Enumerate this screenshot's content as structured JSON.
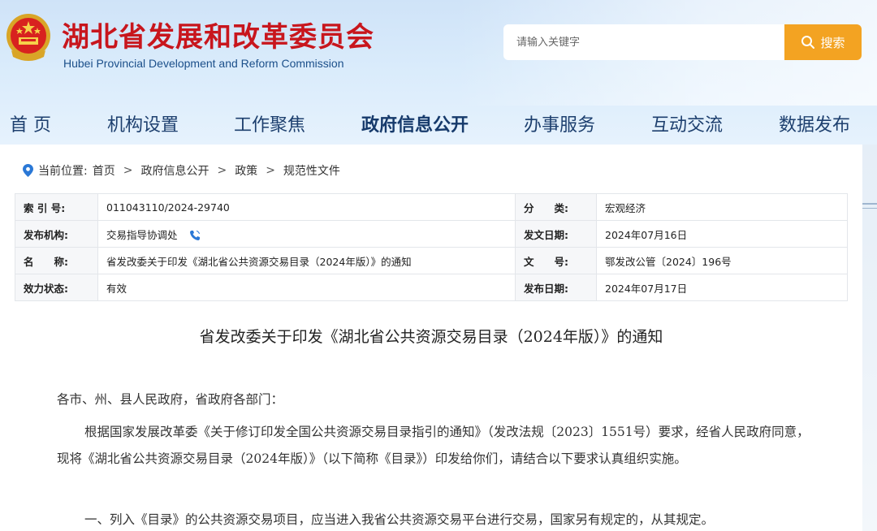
{
  "site": {
    "title": "湖北省发展和改革委员会",
    "subtitle": "Hubei Provincial Development and Reform Commission"
  },
  "search": {
    "placeholder": "请输入关键字",
    "button_label": "搜索"
  },
  "nav": {
    "items": [
      {
        "label": "首 页"
      },
      {
        "label": "机构设置"
      },
      {
        "label": "工作聚焦"
      },
      {
        "label": "政府信息公开",
        "active": true
      },
      {
        "label": "办事服务"
      },
      {
        "label": "互动交流"
      },
      {
        "label": "数据发布"
      }
    ]
  },
  "breadcrumb": {
    "prefix": "当前位置:",
    "items": [
      "首页",
      "政府信息公开",
      "政策",
      "规范性文件"
    ]
  },
  "meta": {
    "index_label": "索 引 号:",
    "index_value": "011043110/2024-29740",
    "category_label": "分　　类:",
    "category_value": "宏观经济",
    "publisher_label": "发布机构:",
    "publisher_value": "交易指导协调处",
    "issue_date_label": "发文日期:",
    "issue_date_value": "2024年07月16日",
    "name_label": "名　　称:",
    "name_value": "省发改委关于印发《湖北省公共资源交易目录（2024年版）》的通知",
    "doc_no_label": "文　　号:",
    "doc_no_value": "鄂发改公管〔2024〕196号",
    "status_label": "效力状态:",
    "status_value": "有效",
    "publish_date_label": "发布日期:",
    "publish_date_value": "2024年07月17日"
  },
  "document": {
    "title": "省发改委关于印发《湖北省公共资源交易目录（2024年版）》的通知",
    "salutation": "各市、州、县人民政府，省政府各部门：",
    "para1": "根据国家发展改革委《关于修订印发全国公共资源交易目录指引的通知》（发改法规〔2023〕1551号）要求，经省人民政府同意，现将《湖北省公共资源交易目录（2024年版）》（以下简称《目录》）印发给你们，请结合以下要求认真组织实施。",
    "para2": "一、列入《目录》的公共资源交易项目，应当进入我省公共资源交易平台进行交易，国家另有规定的，从其规定。"
  },
  "colors": {
    "brand_red": "#c8161d",
    "nav_blue": "#1d3f6e",
    "search_orange": "#f3a322",
    "breadcrumb_icon_blue": "#2a78d6"
  },
  "icons": {
    "emblem": "national-emblem",
    "search": "search-icon",
    "location": "location-pin-icon",
    "phone": "phone-icon"
  }
}
